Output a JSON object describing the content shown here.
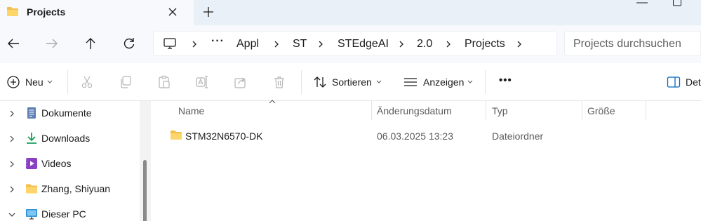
{
  "tab": {
    "title": "Projects",
    "icon": "folder-icon"
  },
  "colors": {
    "folder": "#f4bf4f",
    "accent": "#0067c0"
  },
  "address": {
    "overflow": "···",
    "crumbs": [
      "Appl",
      "ST",
      "STEdgeAI",
      "2.0",
      "Projects"
    ]
  },
  "search": {
    "placeholder": "Projects durchsuchen"
  },
  "toolbar": {
    "new_label": "Neu",
    "sort_label": "Sortieren",
    "view_label": "Anzeigen",
    "more_label": "•••",
    "details_label": "Det"
  },
  "sidebar": {
    "items": [
      {
        "label": "Dokumente",
        "icon": "documents-icon"
      },
      {
        "label": "Downloads",
        "icon": "download-icon"
      },
      {
        "label": "Videos",
        "icon": "videos-icon"
      },
      {
        "label": "Zhang, Shiyuan",
        "icon": "folder-icon"
      },
      {
        "label": "Dieser PC",
        "icon": "computer-icon"
      }
    ]
  },
  "columns": {
    "name": "Name",
    "date": "Änderungsdatum",
    "type": "Typ",
    "size": "Größe"
  },
  "files": [
    {
      "name": "STM32N6570-DK",
      "date": "06.03.2025 13:23",
      "type": "Dateiordner",
      "size": ""
    }
  ]
}
